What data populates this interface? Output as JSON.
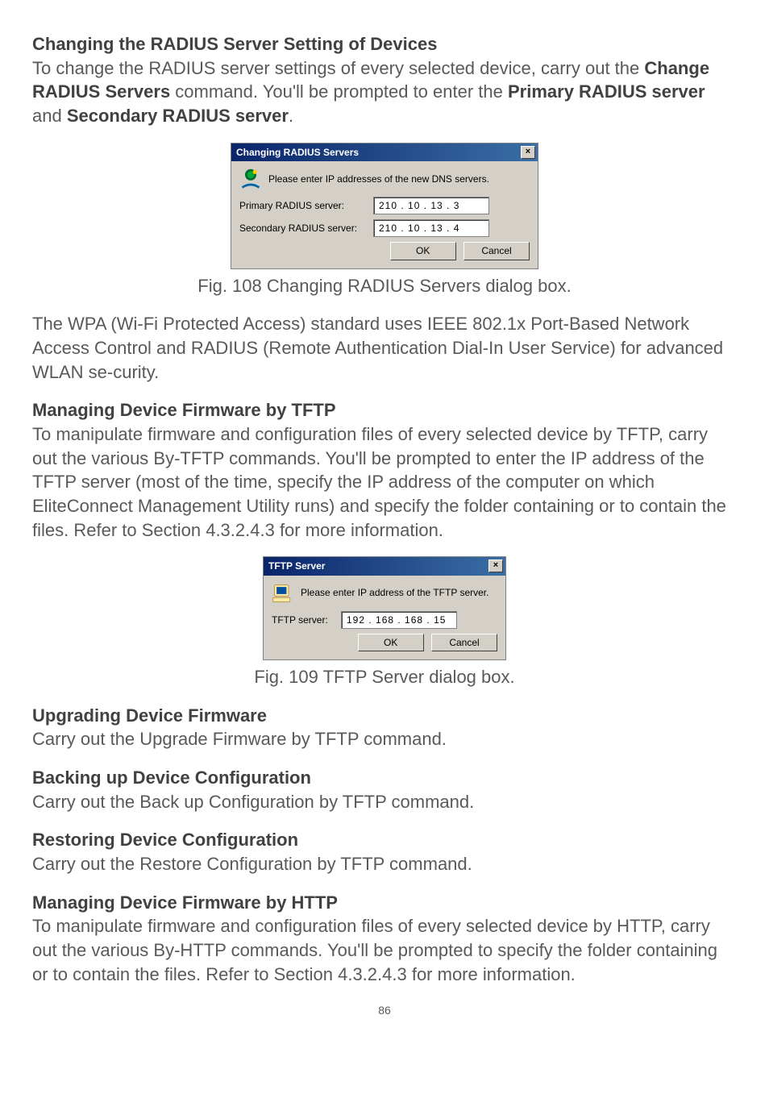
{
  "sections": {
    "radius_heading": "Changing the RADIUS Server Setting of Devices",
    "radius_para_a": "To change the RADIUS server settings of every selected device, carry out the ",
    "radius_para_bold1": "Change RADIUS Servers",
    "radius_para_b": " command. You'll be prompted to enter the ",
    "radius_para_bold2": "Primary RADIUS server",
    "radius_para_c": " and ",
    "radius_para_bold3": "Secondary RADIUS server",
    "radius_para_d": ".",
    "fig108": "Fig. 108 Changing RADIUS Servers dialog box.",
    "wpa_para": "The WPA (Wi-Fi Protected Access) standard uses IEEE 802.1x Port-Based Network Access Control and RADIUS (Remote Authentication Dial-In User Service) for advanced WLAN se-curity.",
    "tftp_heading": "Managing Device Firmware by TFTP",
    "tftp_para": "To manipulate firmware and configuration files of every selected device by TFTP, carry out the various By-TFTP commands. You'll be prompted to enter the IP address of the TFTP server (most of the time, specify the IP address of the computer on which EliteConnect Management Utility runs) and specify the folder containing or to contain the files. Refer to Section 4.3.2.4.3 for more information.",
    "fig109": "Fig. 109 TFTP Server dialog box.",
    "upgrade_heading": "Upgrading Device Firmware",
    "upgrade_para": "Carry out the Upgrade Firmware by TFTP command.",
    "backup_heading": "Backing up Device Configuration",
    "backup_para": "Carry out the Back up Configuration by TFTP command.",
    "restore_heading": "Restoring Device Configuration",
    "restore_para": "Carry out the Restore Configuration by TFTP command.",
    "http_heading": "Managing Device Firmware by HTTP",
    "http_para": "To manipulate firmware and configuration files of every selected device by HTTP, carry out the various By-HTTP commands. You'll be prompted to specify the folder containing or to contain the files. Refer to Section 4.3.2.4.3 for more information.",
    "page_number": "86"
  },
  "dialog_radius": {
    "title": "Changing RADIUS Servers",
    "close_x": "×",
    "prompt": "Please enter IP addresses of the new DNS servers.",
    "primary_label": "Primary RADIUS server:",
    "primary_ip": "210 .  10  .  13  .   3",
    "secondary_label": "Secondary RADIUS server:",
    "secondary_ip": "210 .  10  .  13  .   4",
    "ok": "OK",
    "cancel": "Cancel"
  },
  "dialog_tftp": {
    "title": "TFTP Server",
    "close_x": "×",
    "prompt": "Please enter IP address of the TFTP server.",
    "label": "TFTP server:",
    "ip": "192 . 168 . 168 .  15",
    "ok": "OK",
    "cancel": "Cancel"
  }
}
